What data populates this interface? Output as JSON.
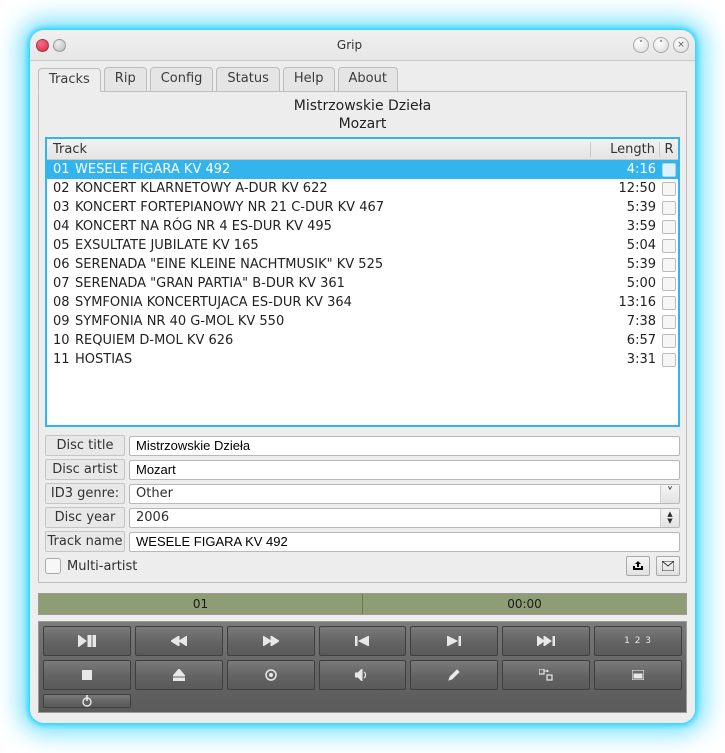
{
  "window": {
    "title": "Grip"
  },
  "tabs": [
    {
      "label": "Tracks"
    },
    {
      "label": "Rip"
    },
    {
      "label": "Config"
    },
    {
      "label": "Status"
    },
    {
      "label": "Help"
    },
    {
      "label": "About"
    }
  ],
  "disc": {
    "title_display": "Mistrzowskie Dzieła",
    "artist_display": "Mozart"
  },
  "columns": {
    "track": "Track",
    "length": "Length",
    "rip": "R"
  },
  "tracks": [
    {
      "num": "01",
      "title": "WESELE FIGARA KV 492",
      "length": "4:16",
      "selected": true
    },
    {
      "num": "02",
      "title": "KONCERT KLARNETOWY A-DUR KV 622",
      "length": "12:50",
      "selected": false
    },
    {
      "num": "03",
      "title": "KONCERT FORTEPIANOWY NR 21 C-DUR KV 467",
      "length": "5:39",
      "selected": false
    },
    {
      "num": "04",
      "title": "KONCERT NA RÓG NR 4 ES-DUR KV 495",
      "length": "3:59",
      "selected": false
    },
    {
      "num": "05",
      "title": "EXSULTATE JUBILATE KV 165",
      "length": "5:04",
      "selected": false
    },
    {
      "num": "06",
      "title": "SERENADA \"EINE KLEINE NACHTMUSIK\" KV 525",
      "length": "5:39",
      "selected": false
    },
    {
      "num": "07",
      "title": "SERENADA \"GRAN PARTIA\" B-DUR KV 361",
      "length": "5:00",
      "selected": false
    },
    {
      "num": "08",
      "title": "SYMFONIA KONCERTUJACA ES-DUR KV 364",
      "length": "13:16",
      "selected": false
    },
    {
      "num": "09",
      "title": "SYMFONIA NR 40 G-MOL KV 550",
      "length": "7:38",
      "selected": false
    },
    {
      "num": "10",
      "title": "REQUIEM D-MOL KV 626",
      "length": "6:57",
      "selected": false
    },
    {
      "num": "11",
      "title": "HOSTIAS",
      "length": "3:31",
      "selected": false
    }
  ],
  "form": {
    "labels": {
      "disc_title": "Disc title",
      "disc_artist": "Disc artist",
      "id3_genre": "ID3 genre:",
      "disc_year": "Disc year",
      "track_name": "Track name",
      "multi_artist": "Multi-artist"
    },
    "values": {
      "disc_title": "Mistrzowskie Dzieła",
      "disc_artist": "Mozart",
      "id3_genre": "Other",
      "disc_year": "2006",
      "track_name": "WESELE FIGARA KV 492"
    }
  },
  "progress": {
    "track": "01",
    "time": "00:00"
  },
  "toolbar_abc": "1 2 3"
}
